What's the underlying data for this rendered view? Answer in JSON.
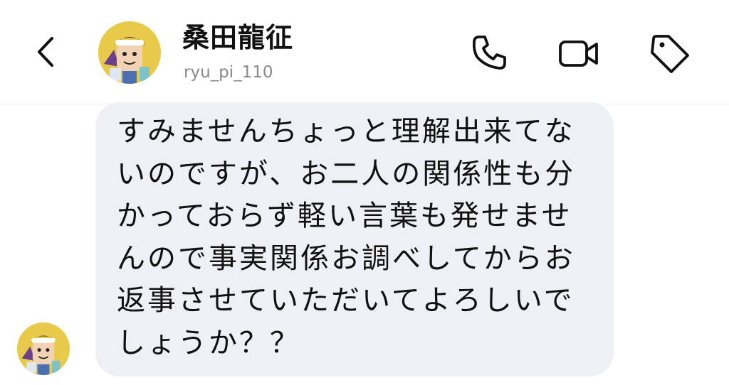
{
  "header": {
    "contact_name": "桑田龍征",
    "contact_handle": "ryu_pi_110",
    "icons": {
      "back": "chevron-left-icon",
      "call": "phone-icon",
      "video": "video-camera-icon",
      "tag": "tag-icon"
    }
  },
  "conversation": {
    "messages": [
      {
        "sender": "桑田龍征",
        "text": "すみませんちょっと理解出来てないのですが、お二人の関係性も分かっておらず軽い言葉も発せませんので事実関係お調べしてからお返事させていただいてよろしいでしょうか？？"
      }
    ]
  },
  "colors": {
    "bubble_background": "#eff0f5",
    "handle_gray": "#8a8a8a",
    "icon_black": "#111111",
    "avatar_yellow": "#e9c94a"
  }
}
